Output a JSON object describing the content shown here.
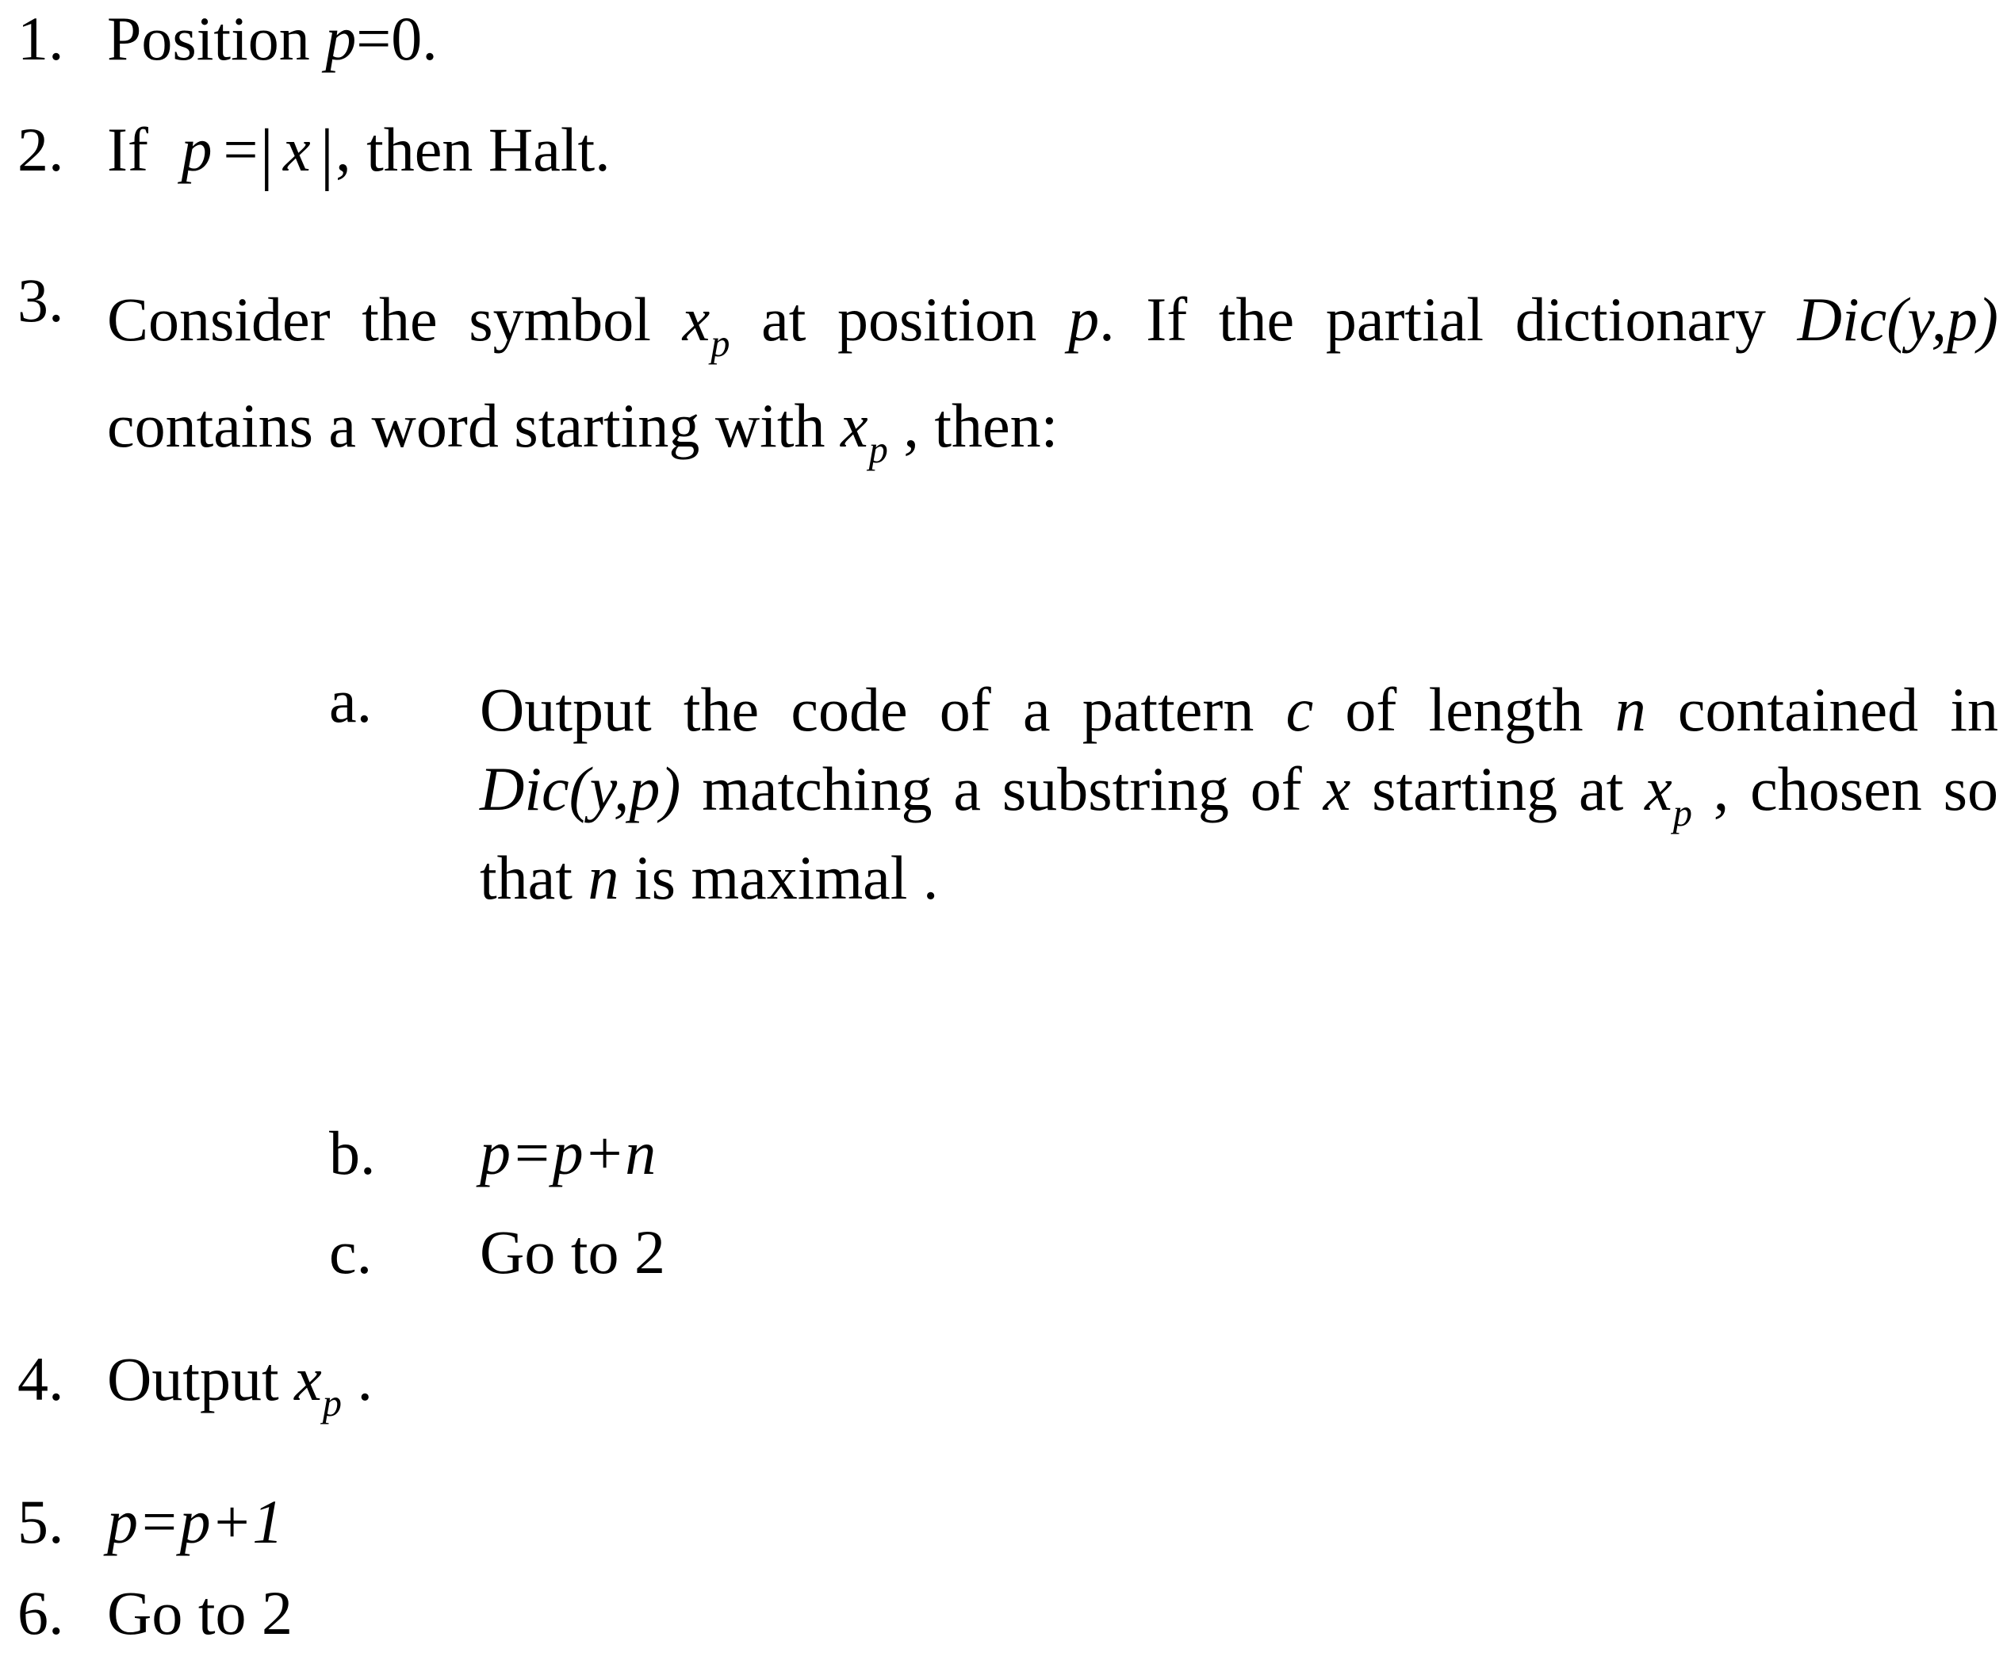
{
  "document": {
    "kind": "numbered-algorithm-steps",
    "text_color": "#000000",
    "background_color": "#ffffff"
  },
  "steps": [
    {
      "marker": "1.",
      "id": "step-1",
      "plain": "Position p=0.",
      "parts": {
        "lead": "Position ",
        "var_p": "p",
        "tail": "=0."
      }
    },
    {
      "marker": "2.",
      "id": "step-2",
      "plain": "If p =| x |, then Halt.",
      "parts": {
        "lead": "If ",
        "var_p": "p",
        "eq": "=",
        "bar_open": "|",
        "var_x": "x",
        "bar_close": "|",
        "tail": ", then Halt."
      }
    },
    {
      "marker": "3.",
      "id": "step-3",
      "plain": "Consider the symbol x p at position p. If the partial dictionary Dic(y,p) contains a word starting with x p , then:",
      "parts": {
        "seg1": "Consider the symbol ",
        "var_x1": "x",
        "sub_p1": "p",
        "seg2": " at position ",
        "var_p1": "p",
        "seg3": ". If the partial dictionary ",
        "dic1": "Dic(y,p)",
        "seg4": " contains a word starting with ",
        "var_x2": "x",
        "sub_p2": "p",
        "seg5": " , then:"
      },
      "substeps": [
        {
          "marker": "a.",
          "id": "step-3a",
          "plain": "Output the code of a pattern c of length n contained in Dic(y,p) matching a substring of x starting at x p , chosen so that n is maximal .",
          "parts": {
            "seg1": "Output the code of a pattern ",
            "var_c": "c",
            "seg2": " of length ",
            "var_n1": "n",
            "seg3": " contained in ",
            "dic": "Dic(y,p)",
            "seg4": " matching a substring of ",
            "var_x1": "x",
            "seg5": " starting at ",
            "var_x2": "x",
            "sub_p": "p",
            "seg6": " , chosen so that ",
            "var_n2": "n",
            "seg7": " is maximal ."
          }
        },
        {
          "marker": "b.",
          "id": "step-3b",
          "plain": "p=p+n",
          "parts": {
            "formula": "p=p+n"
          }
        },
        {
          "marker": "c.",
          "id": "step-3c",
          "plain": "Go to 2",
          "parts": {
            "text": "Go to 2"
          }
        }
      ]
    },
    {
      "marker": "4.",
      "id": "step-4",
      "plain": "Output x p .",
      "parts": {
        "lead": "Output ",
        "var_x": "x",
        "sub_p": "p",
        "tail": " ."
      }
    },
    {
      "marker": "5.",
      "id": "step-5",
      "plain": "p=p+1",
      "parts": {
        "formula": "p=p+1"
      }
    },
    {
      "marker": "6.",
      "id": "step-6",
      "plain": "Go to 2",
      "parts": {
        "text": "Go to 2"
      }
    }
  ]
}
